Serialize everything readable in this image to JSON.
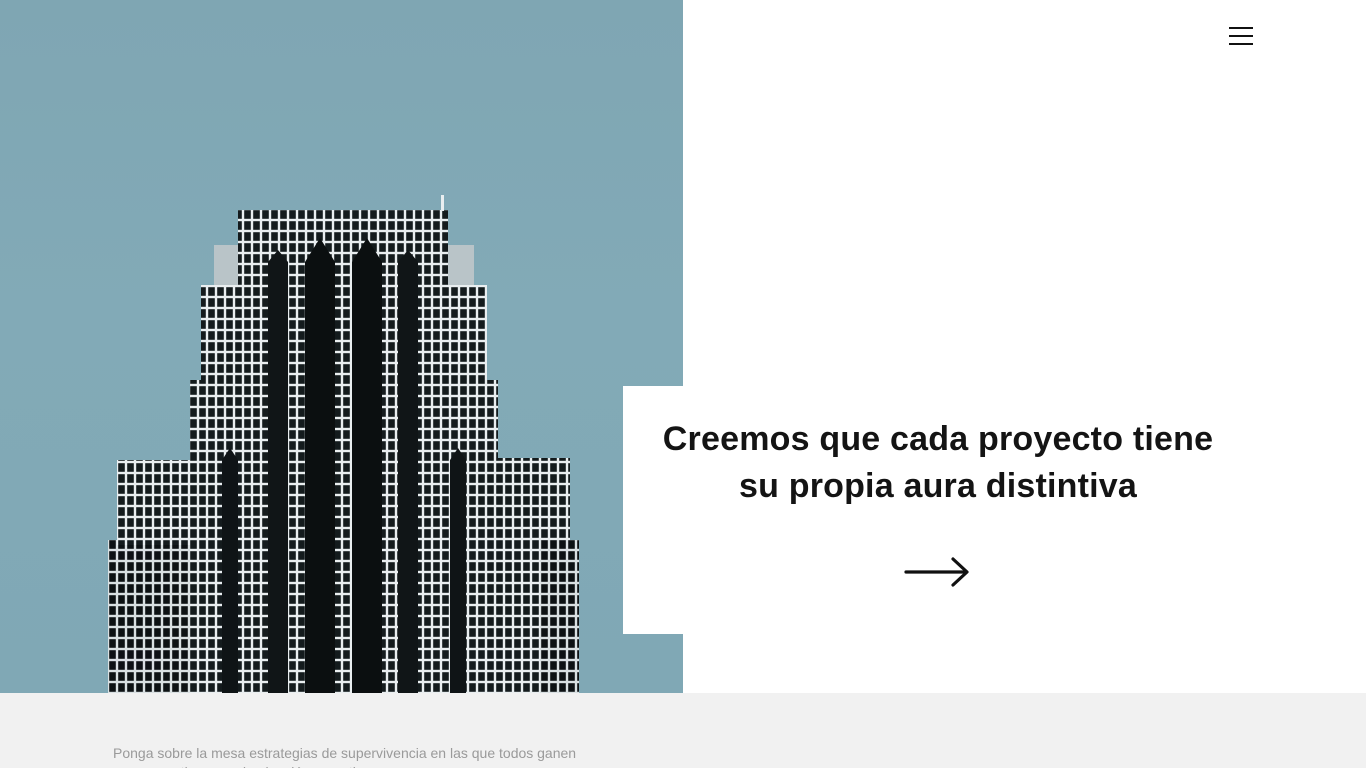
{
  "hero": {
    "image_label": "skyscraper-photo",
    "sky_color": "#80a8b5"
  },
  "header": {
    "menu_icon": "hamburger-menu-icon"
  },
  "headline": {
    "line1": "Creemos que cada proyecto tiene",
    "line2": "su propia aura distintiva",
    "link_icon": "arrow-right-icon"
  },
  "intro": {
    "text": "Ponga sobre la mesa estrategias de supervivencia en las que todos ganen para garantizar una dominación proactiva."
  },
  "colors": {
    "text_dark": "#141414",
    "muted_text": "#9a9a9a",
    "bottom_bg": "#f1f1f1"
  }
}
